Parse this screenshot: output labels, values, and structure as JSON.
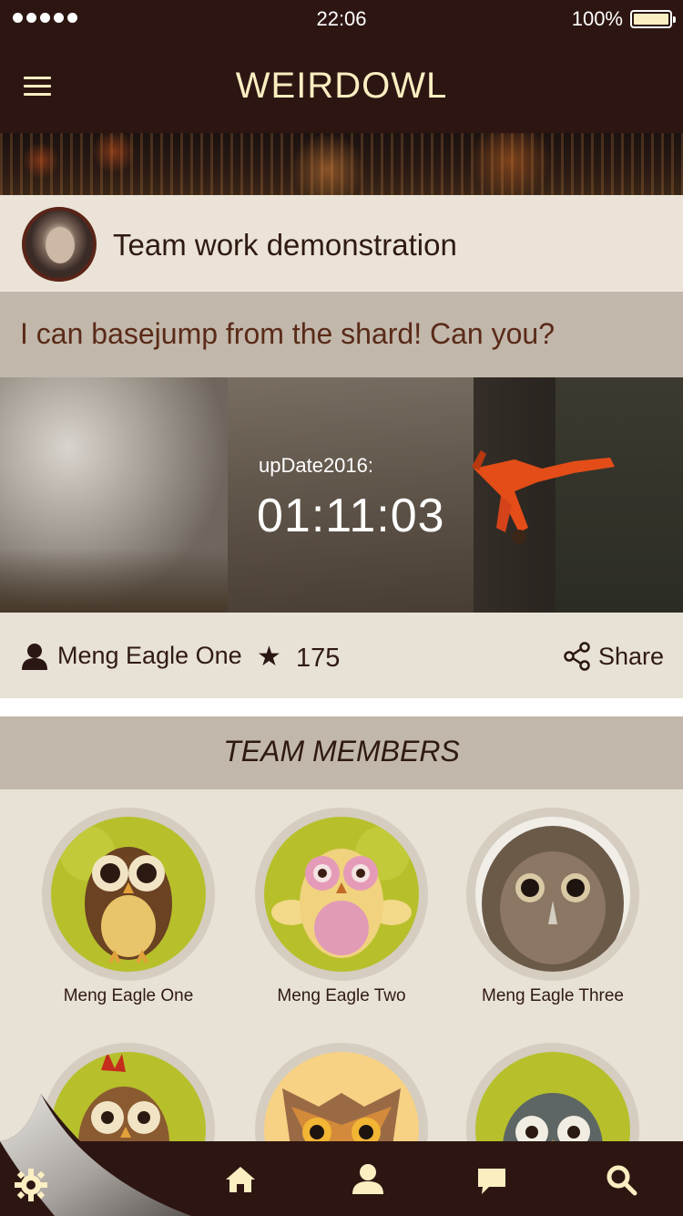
{
  "status_bar": {
    "time": "22:06",
    "battery_percent": "100%",
    "signal_dots": 5
  },
  "header": {
    "title": "WEIRDOWL",
    "menu_icon": "hamburger-icon"
  },
  "post": {
    "title": "Team work demonstration",
    "caption": "I can basejump from the shard! Can you?",
    "media": {
      "update_label": "upDate2016:",
      "timer": "01:11:03"
    },
    "author": "Meng Eagle One",
    "stars": "175",
    "share_label": "Share"
  },
  "team": {
    "title": "TEAM MEMBERS",
    "members": [
      {
        "name": "Meng Eagle One"
      },
      {
        "name": "Meng Eagle Two"
      },
      {
        "name": "Meng Eagle Three"
      },
      {
        "name": ""
      },
      {
        "name": ""
      },
      {
        "name": ""
      }
    ]
  },
  "tab_bar": {
    "items": [
      "settings-icon",
      "home-icon",
      "profile-icon",
      "chat-icon",
      "search-icon"
    ]
  },
  "colors": {
    "header_bg": "#2d1612",
    "header_text": "#fbeec1",
    "page_bg": "#e8e1d6",
    "band_bg": "#c1b7aa",
    "accent_text": "#5a2a18"
  }
}
